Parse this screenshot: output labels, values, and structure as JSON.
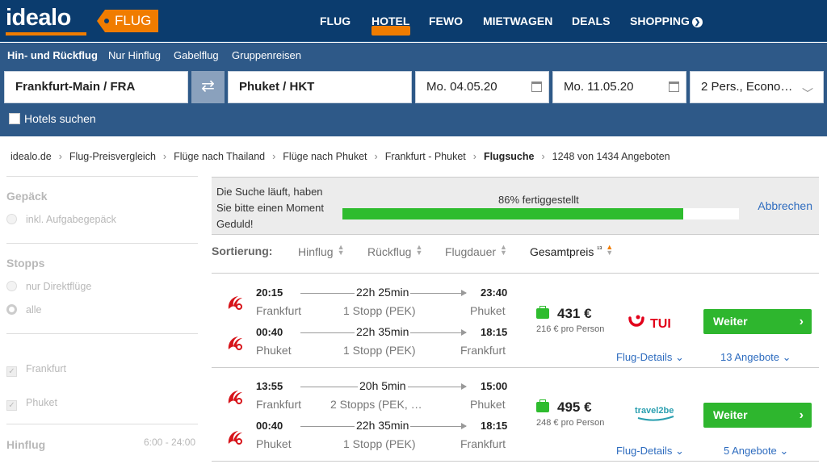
{
  "header": {
    "logo": "idealo",
    "section_tag": "FLUG",
    "nav": [
      "FLUG",
      "HOTEL",
      "FEWO",
      "MIETWAGEN",
      "DEALS",
      "SHOPPING"
    ],
    "active_nav": "HOTEL",
    "brand_color": "#0b3c6e",
    "accent_color": "#f07c00"
  },
  "search": {
    "tabs": [
      "Hin- und Rückflug",
      "Nur Hinflug",
      "Gabelflug",
      "Gruppenreisen"
    ],
    "active_tab": "Hin- und Rückflug",
    "origin": "Frankfurt-Main / FRA",
    "destination": "Phuket / HKT",
    "depart_date": "Mo. 04.05.20",
    "return_date": "Mo. 11.05.20",
    "passengers": "2 Pers., Econo…",
    "hotels_label": "Hotels suchen",
    "icons": {
      "swap": "swap-arrows-icon",
      "calendar": "calendar-icon",
      "dropdown": "chevron-down-icon"
    }
  },
  "breadcrumb": {
    "items": [
      "idealo.de",
      "Flug-Preisvergleich",
      "Flüge nach Thailand",
      "Flüge nach Phuket",
      "Frankfurt - Phuket",
      "Flugsuche"
    ],
    "count": "1248 von 1434 Angeboten"
  },
  "sidebar": {
    "gepaeck_title": "Gepäck",
    "gepaeck_option": "inkl. Aufgabegepäck",
    "stopps_title": "Stopps",
    "stopps_options": [
      "nur Direktflüge",
      "alle"
    ],
    "airports": [
      "Frankfurt",
      "Phuket"
    ],
    "hinflug_title": "Hinflug",
    "hinflug_range": "6:00 - 24:00"
  },
  "progress": {
    "message": "Die Suche läuft, haben Sie bitte einen Moment Geduld!",
    "label": "86% fertiggestellt",
    "percent": 86,
    "cancel": "Abbrechen",
    "bar_color": "#2ebc2e"
  },
  "sort": {
    "label": "Sortierung:",
    "options": [
      "Hinflug",
      "Rückflug",
      "Flugdauer",
      "Gesamtpreis"
    ],
    "active": "Gesamtpreis",
    "active_marker": "¹³"
  },
  "results": [
    {
      "outbound": {
        "dep_time": "20:15",
        "duration": "22h 25min",
        "arr_time": "23:40",
        "from": "Frankfurt",
        "stops": "1 Stopp (PEK)",
        "to": "Phuket"
      },
      "inbound": {
        "dep_time": "00:40",
        "duration": "22h 35min",
        "arr_time": "18:15",
        "from": "Phuket",
        "stops": "1 Stopp (PEK)",
        "to": "Frankfurt"
      },
      "price": "431 €",
      "per_person": "216 € pro Person",
      "vendor": "TUI",
      "button": "Weiter",
      "details": "Flug-Details",
      "offers": "13 Angebote"
    },
    {
      "outbound": {
        "dep_time": "13:55",
        "duration": "20h 5min",
        "arr_time": "15:00",
        "from": "Frankfurt",
        "stops": "2 Stopps (PEK, …",
        "to": "Phuket"
      },
      "inbound": {
        "dep_time": "00:40",
        "duration": "22h 35min",
        "arr_time": "18:15",
        "from": "Phuket",
        "stops": "1 Stopp (PEK)",
        "to": "Frankfurt"
      },
      "price": "495 €",
      "per_person": "248 € pro Person",
      "vendor": "travel2be",
      "button": "Weiter",
      "details": "Flug-Details",
      "offers": "5 Angebote"
    }
  ],
  "colors": {
    "airline_red": "#d7141a",
    "link_blue": "#2e6cbf",
    "button_green": "#2eb62e",
    "tui_red": "#e2001a",
    "travel2be": "#2a9fb0"
  }
}
